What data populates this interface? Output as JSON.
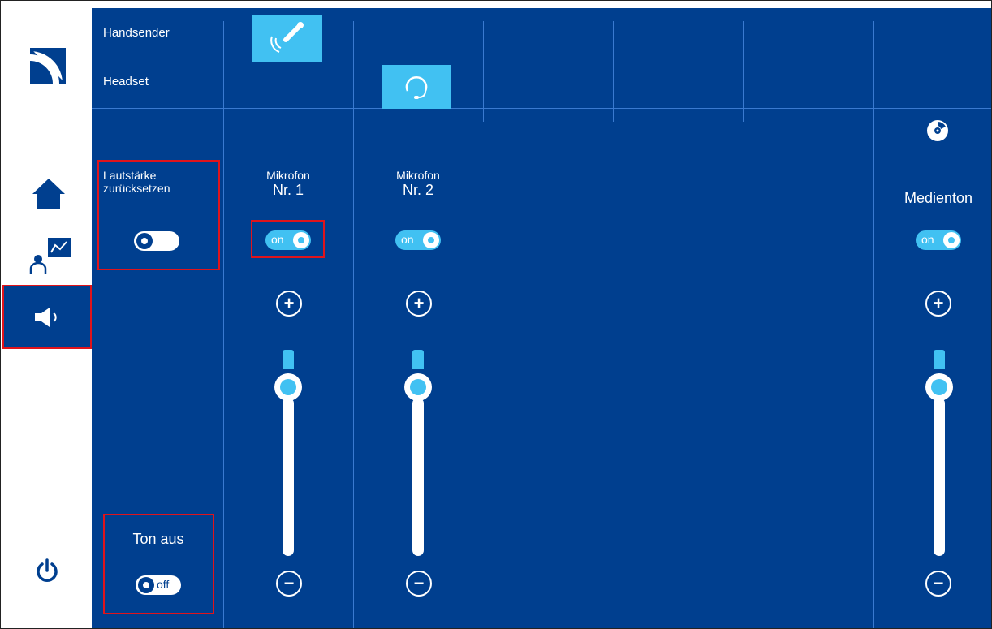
{
  "rows": {
    "handsender_label": "Handsender",
    "headset_label": "Headset"
  },
  "reset": {
    "label_line1": "Lautstärke",
    "label_line2": "zurücksetzen"
  },
  "mute": {
    "label": "Ton aus",
    "toggle_text": "off"
  },
  "channels": [
    {
      "title_line1": "Mikrofon",
      "title_line2": "Nr. 1",
      "toggle_text": "on",
      "plus": "+",
      "minus": "−",
      "level": 0.85
    },
    {
      "title_line1": "Mikrofon",
      "title_line2": "Nr. 2",
      "toggle_text": "on",
      "plus": "+",
      "minus": "−",
      "level": 0.85
    },
    {
      "title_line1": "",
      "title_line2": "Medienton",
      "toggle_text": "on",
      "plus": "+",
      "minus": "−",
      "level": 0.85
    }
  ],
  "icons": {
    "logo": "logo-icon",
    "home": "home-icon",
    "presentation": "presenter-icon",
    "speaker": "speaker-icon",
    "power": "power-icon",
    "microphone": "microphone-icon",
    "headset": "headset-icon",
    "disc": "disc-icon"
  },
  "colors": {
    "background": "#003f8f",
    "accent": "#41c1f2",
    "highlight": "#e0141b"
  }
}
